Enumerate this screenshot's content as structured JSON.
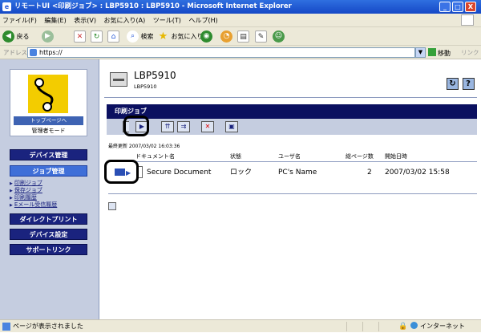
{
  "window": {
    "title": "リモートUI <印刷ジョブ> : LBP5910 : LBP5910 - Microsoft Internet Explorer",
    "minimize": "_",
    "maximize": "□",
    "close": "X"
  },
  "menubar": {
    "items": [
      "ファイル(F)",
      "編集(E)",
      "表示(V)",
      "お気に入り(A)",
      "ツール(T)",
      "ヘルプ(H)"
    ]
  },
  "toolbar": {
    "back_label": "戻る",
    "search_label": "検索",
    "favorites_label": "お気に入り"
  },
  "addressbar": {
    "label": "アドレス(D)",
    "url": "https://",
    "go_label": "移動",
    "links_label": "リンク"
  },
  "sidebar": {
    "home_label": "トップページへ",
    "mode_label": "管理者モード",
    "nav": [
      {
        "label": "デバイス管理"
      },
      {
        "label": "ジョブ管理"
      },
      {
        "label": "ダイレクトプリント"
      },
      {
        "label": "デバイス設定"
      },
      {
        "label": "サポートリンク"
      }
    ],
    "sublinks": [
      "印刷ジョブ",
      "保存ジョブ",
      "印刷履歴",
      "Eメール受信履歴"
    ]
  },
  "device": {
    "name": "LBP5910",
    "subname": "LBP5910",
    "refresh_icon_glyph": "↻",
    "help_icon_glyph": "?"
  },
  "job": {
    "bar_title": "印刷ジョブ",
    "last_updated": "最終更新 2007/03/02 16:03:36",
    "columns": [
      "ドキュメント名",
      "状態",
      "ユーザ名",
      "総ページ数",
      "開始日時"
    ],
    "rows": [
      {
        "doc": "Secure Document",
        "status": "ロック",
        "user": "PC's Name",
        "pages": "2",
        "start": "2007/03/02 15:58"
      }
    ]
  },
  "statusbar": {
    "message": "ページが表示されました",
    "zone": "インターネット"
  },
  "colors": {
    "nav_dark": "#1a237e",
    "nav_active": "#3f6fd8",
    "sidebar_bg": "#c5cde0",
    "jobbar": "#0b1060"
  }
}
